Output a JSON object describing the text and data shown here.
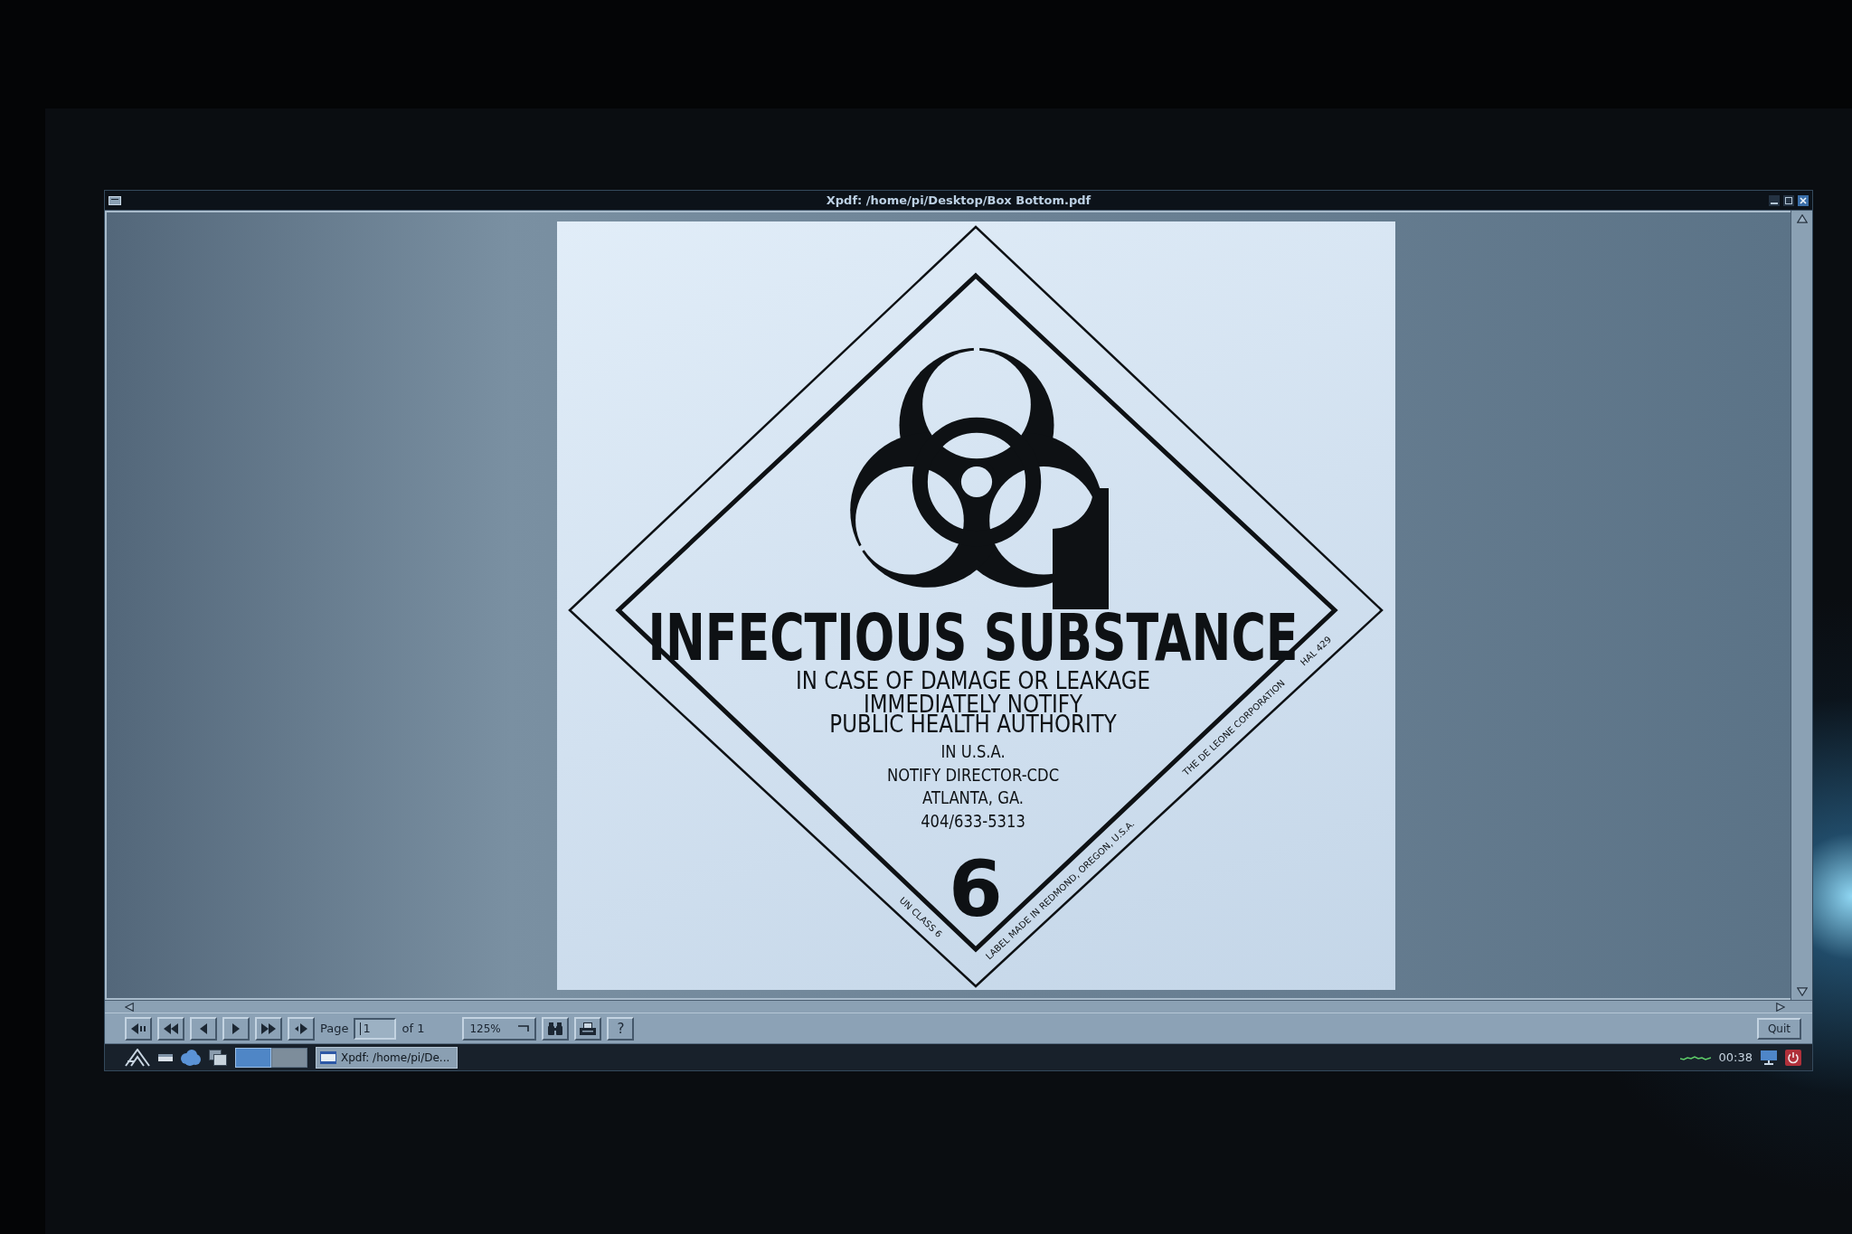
{
  "window": {
    "title": "Xpdf: /home/pi/Desktop/Box Bottom.pdf"
  },
  "document": {
    "label": {
      "heading": "INFECTIOUS SUBSTANCE",
      "instructions": [
        "IN CASE OF DAMAGE OR LEAKAGE",
        "IMMEDIATELY NOTIFY",
        "PUBLIC HEALTH AUTHORITY"
      ],
      "contact": [
        "IN U.S.A.",
        "NOTIFY DIRECTOR-CDC",
        "ATLANTA, GA.",
        "404/633-5313"
      ],
      "class_number": "6",
      "edge_texts": [
        "UN CLASS 6",
        "LABEL MADE IN REDMOND, OREGON, U.S.A.",
        "THE DE LEONE CORPORATION",
        "HAL 429"
      ]
    }
  },
  "toolbar": {
    "page_label": "Page",
    "page_input": {
      "value": "1"
    },
    "page_count": "of 1",
    "zoom": "125%",
    "help_button": "?",
    "quit_button": "Quit"
  },
  "taskbar": {
    "desktops": [
      {
        "selected": true
      },
      {
        "selected": false
      }
    ],
    "tasks": [
      {
        "label": "Xpdf: /home/pi/De..."
      }
    ],
    "clock": "00:38"
  }
}
